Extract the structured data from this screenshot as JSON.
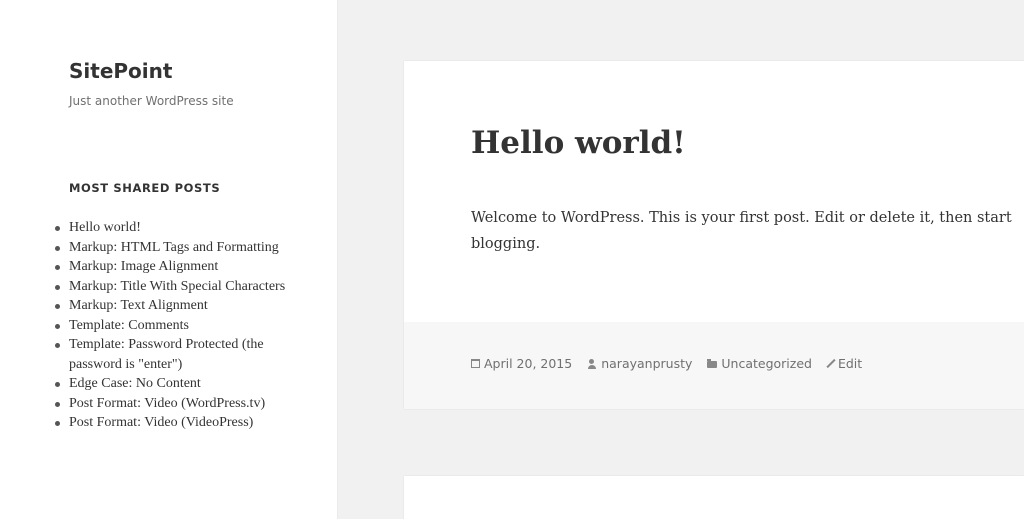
{
  "site": {
    "title": "SitePoint",
    "description": "Just another WordPress site"
  },
  "widget": {
    "title": "MOST SHARED POSTS",
    "items": [
      "Hello world!",
      "Markup: HTML Tags and Formatting",
      "Markup: Image Alignment",
      "Markup: Title With Special Characters",
      "Markup: Text Alignment",
      "Template: Comments",
      "Template: Password Protected (the password is \"enter\")",
      "Edge Case: No Content",
      "Post Format: Video (WordPress.tv)",
      "Post Format: Video (VideoPress)"
    ]
  },
  "post": {
    "title": "Hello world!",
    "content": "Welcome to WordPress. This is your first post. Edit or delete it, then start blogging.",
    "meta": {
      "date": "April 20, 2015",
      "author": "narayanprusty",
      "category": "Uncategorized",
      "edit": "Edit"
    }
  },
  "icons": {
    "date": "calendar-icon",
    "author": "user-icon",
    "category": "folder-icon",
    "edit": "pencil-icon"
  },
  "colors": {
    "page_background": "#f1f1f1",
    "card_background": "#ffffff",
    "footer_background": "#f7f7f7",
    "text": "#333333",
    "meta_text": "#707070"
  }
}
